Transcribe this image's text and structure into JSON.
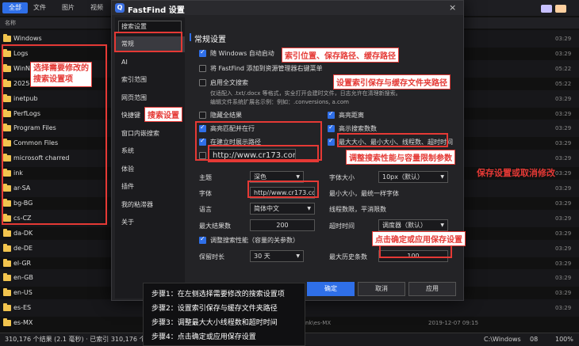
{
  "background": {
    "tabs": [
      "全部",
      "文件",
      "图片",
      "视频"
    ],
    "column_header": "名称",
    "files": [
      {
        "name": "Windows",
        "date": "03:29"
      },
      {
        "name": "Logs",
        "date": "03:29"
      },
      {
        "name": "WinNT",
        "date": "05:22"
      },
      {
        "name": "2025-06",
        "date": "05:22"
      },
      {
        "name": "inetpub",
        "date": "03:29"
      },
      {
        "name": "PerfLogs",
        "date": "03:29"
      },
      {
        "name": "Program Files",
        "date": "03:29"
      },
      {
        "name": "Common Files",
        "date": "03:29"
      },
      {
        "name": "microsoft charred",
        "date": "03:29"
      },
      {
        "name": "ink",
        "date": "03:29"
      },
      {
        "name": "ar-SA",
        "date": "03:29"
      },
      {
        "name": "bg-BG",
        "date": "03:29"
      },
      {
        "name": "cs-CZ",
        "date": "03:29"
      },
      {
        "name": "da-DK",
        "date": "03:29"
      },
      {
        "name": "de-DE",
        "date": "03:29"
      },
      {
        "name": "el-GR",
        "date": "03:29"
      },
      {
        "name": "en-GB",
        "date": "03:29"
      },
      {
        "name": "en-US",
        "date": "03:29"
      },
      {
        "name": "es-ES",
        "date": "03:29"
      },
      {
        "name": "es-MX",
        "date": "2019-12-07 09:15",
        "path": "ink\\es-MX"
      }
    ],
    "status": "310,176 个结果 (2.1 毫秒) · 已索引 310,176 个",
    "status_right_path": "C:\\Windows",
    "status_right_a": "08",
    "status_right_b": "100%"
  },
  "dialog": {
    "title": "FastFind 设置",
    "close": "×",
    "logo": "Q",
    "search_placeholder": "搜索设置",
    "sidebar": [
      "常规",
      "AI",
      "索引范围",
      "网页范围",
      "快捷键",
      "窗口内嵌搜索",
      "系统",
      "体验",
      "插件",
      "我的粘滞器",
      "关于"
    ],
    "section_title": "常规设置",
    "options": {
      "startup": "随 Windows 自动启动",
      "context_menu": "将 FastFind 添加到资源管理器右键菜单",
      "fulltext": "启用全文搜索",
      "fulltext_desc": "仅适配入 .txt/.docx 等格式，实全打开会建时文件，日志允许在清理新搜索。",
      "fulltext_desc2": "编辑文件系统扩展名示例：例如：.conversions, a.com",
      "hide_results": "隐藏全结果",
      "highlight_match": "高亮匹配并在行",
      "quick_filter": "在建立时展示路径",
      "highlight_distance": "高亮距离",
      "show_count": "高示搜索数数",
      "max_size": "最大大小、最小大小、线程数、超时时间",
      "url": "http://www.cr173.com/",
      "theme_label": "主题",
      "theme_value": "深色",
      "font_size_label": "字体大小",
      "font_size_value": "10px（默认）",
      "font_label": "字体",
      "font_value": "http//www.cr173.com/",
      "font_hint": "最小大小，最统一样字体",
      "lang_label": "语言",
      "lang_value": "简体中文",
      "threads_label": "线程数限，平消限数",
      "max_results_label": "最大结果数",
      "max_results_value": "200",
      "timeout_label": "超时时间",
      "timeout_value": "调度器（默认）",
      "debounce": "调整搜索性能（容量的关参数）",
      "interval_label": "保留时长",
      "interval_value": "30 天",
      "history_label": "最大历史条数",
      "history_value": "100"
    },
    "buttons": {
      "ok": "确定",
      "cancel": "取消",
      "apply": "应用"
    }
  },
  "annotations": {
    "select_item": "选择需要修改的\n搜索设置项",
    "search_settings": "搜索设置",
    "index_paths": "索引位置、保存路径、缓存路径",
    "index_save": "设置索引保存与缓存文件夹路径",
    "performance": "调整搜索性能与容量限制参数",
    "save_or_cancel": "保存设置或取消修改",
    "confirm_apply": "点击确定或应用保存设置"
  },
  "steps": [
    "步骤1：在左侧选择需要修改的搜索设置项",
    "步骤2：设置索引保存与缓存文件夹路径",
    "步骤3：调整最大大小线程数和超时时间",
    "步骤4：点击确定或应用保存设置"
  ],
  "colors": {
    "accent": "#2f6fe8",
    "annotation": "#e53935",
    "folder": "#f2c44e"
  }
}
